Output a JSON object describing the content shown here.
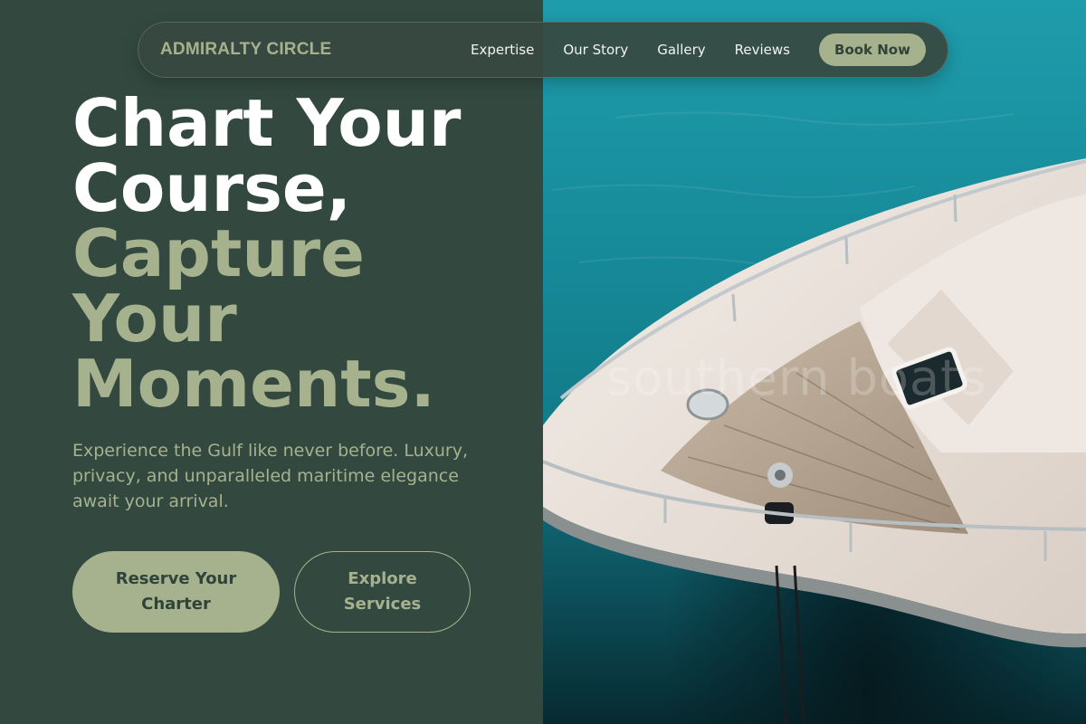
{
  "nav": {
    "brand": "ADMIRALTY CIRCLE",
    "links": [
      "Expertise",
      "Our Story",
      "Gallery",
      "Reviews"
    ],
    "cta_label": "Book Now"
  },
  "hero": {
    "headline_white": [
      "Chart Your",
      "Course,"
    ],
    "headline_accent": [
      "Capture",
      "Your",
      "Moments."
    ],
    "subtitle": "Experience the Gulf like never before. Luxury, privacy, and unparalleled maritime elegance await your arrival.",
    "primary_button": "Reserve Your Charter",
    "secondary_button": "Explore Services"
  },
  "image": {
    "alt": "Aerial view of a white luxury yacht bow on turquoise water",
    "watermark": "southern boats"
  },
  "colors": {
    "background": "#334940",
    "accent": "#a6b28e",
    "text_light": "#ffffff",
    "water": "#168a99"
  }
}
